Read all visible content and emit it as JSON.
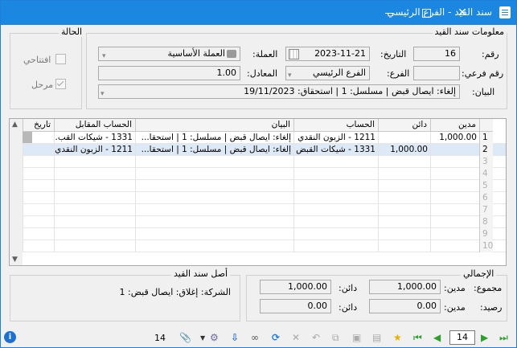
{
  "window": {
    "title": "سند القيد - الفرع الرئيسي"
  },
  "info_group": {
    "title": "معلومات سند القيد",
    "number_label": "رقم:",
    "number_value": "16",
    "date_label": "التاريخ:",
    "date_value": "2023-11-21",
    "currency_label": "العملة:",
    "currency_value": "العملة الأساسية",
    "subnumber_label": "رقم فرعي:",
    "subnumber_value": "",
    "branch_label": "الفرع:",
    "branch_value": "الفرع الرئيسي",
    "rate_label": "المعادل:",
    "rate_value": "1.00",
    "statement_label": "البيان:",
    "statement_value": "إلغاء: ايصال قبض | مسلسل: 1 | استحقاق: 19/11/2023"
  },
  "status_group": {
    "title": "الحالة",
    "opening_label": "افتتاحي",
    "opening_checked": false,
    "posted_label": "مرحل",
    "posted_checked": true
  },
  "grid": {
    "headers": {
      "debit": "مدين",
      "credit": "دائن",
      "account": "الحساب",
      "statement": "البيان",
      "counter_account": "الحساب المقابل",
      "date": "تاريخ"
    },
    "rows": [
      {
        "num": "1",
        "debit": "1,000.00",
        "credit": "",
        "account": "1211 - الزبون النقدي",
        "statement": "إلغاء: ايصال قبض | مسلسل: 1 | استحقا...",
        "counter_account": "1331 - شيكات القب...",
        "date": ""
      },
      {
        "num": "2",
        "debit": "",
        "credit": "1,000.00",
        "account": "1331 - شيكات القبض",
        "statement": "إلغاء: ايصال قبض | مسلسل: 1 | استحقا...",
        "counter_account": "1211 - الزبون النقدي",
        "date": ""
      },
      {
        "num": "3",
        "debit": "",
        "credit": "",
        "account": "",
        "statement": "",
        "counter_account": "",
        "date": ""
      },
      {
        "num": "4",
        "debit": "",
        "credit": "",
        "account": "",
        "statement": "",
        "counter_account": "",
        "date": ""
      },
      {
        "num": "5",
        "debit": "",
        "credit": "",
        "account": "",
        "statement": "",
        "counter_account": "",
        "date": ""
      },
      {
        "num": "6",
        "debit": "",
        "credit": "",
        "account": "",
        "statement": "",
        "counter_account": "",
        "date": ""
      },
      {
        "num": "7",
        "debit": "",
        "credit": "",
        "account": "",
        "statement": "",
        "counter_account": "",
        "date": ""
      },
      {
        "num": "8",
        "debit": "",
        "credit": "",
        "account": "",
        "statement": "",
        "counter_account": "",
        "date": ""
      },
      {
        "num": "9",
        "debit": "",
        "credit": "",
        "account": "",
        "statement": "",
        "counter_account": "",
        "date": ""
      },
      {
        "num": "10",
        "debit": "",
        "credit": "",
        "account": "",
        "statement": "",
        "counter_account": "",
        "date": ""
      }
    ]
  },
  "totals_group": {
    "title": "الإجمالي",
    "sum_label": "مجموع:",
    "balance_label": "رصيد:",
    "debit_label": "مدين:",
    "credit_label": "دائن:",
    "sum_debit": "1,000.00",
    "sum_credit": "1,000.00",
    "balance_debit": "0.00",
    "balance_credit": "0.00"
  },
  "origin_group": {
    "title": "أصل سند القيد",
    "text": "الشركة: إغلاق: ايصال قبض: 1"
  },
  "toolbar": {
    "record_count": "14",
    "page_value": "14"
  },
  "colors": {
    "titlebar": "#1c87e0",
    "selected_row": "#dde9f7",
    "nav_green": "#2e9e2e"
  }
}
